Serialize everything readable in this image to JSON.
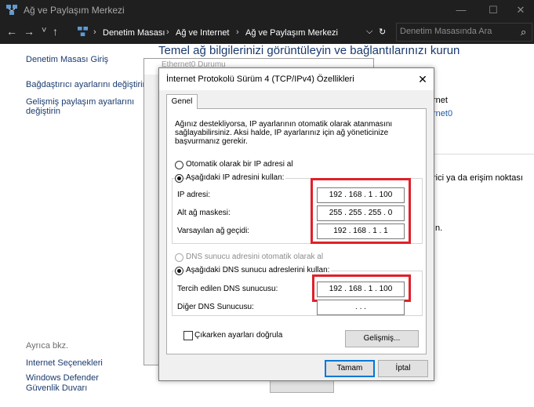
{
  "window": {
    "title": "Ağ ve Paylaşım Merkezi",
    "minimize": "—",
    "maximize": "☐",
    "close": "✕"
  },
  "addressbar": {
    "back": "←",
    "forward": "→",
    "recent": "˅",
    "up": "↑",
    "crumbs": [
      "Denetim Masası",
      "Ağ ve Internet",
      "Ağ ve Paylaşım Merkezi"
    ],
    "separator": "›",
    "dropdown": "⌵",
    "refresh": "↻",
    "search_placeholder": "Denetim Masasında Ara",
    "search_icon": "⌕"
  },
  "sidebar": {
    "home": "Denetim Masası Giriş",
    "items": [
      "Bağdaştırıcı ayarlarını değiştirin",
      "Gelişmiş paylaşım ayarlarını değiştirin"
    ],
    "see_also": "Ayrıca bkz.",
    "see_also_items": [
      "Internet Seçenekleri",
      "Windows Defender Güvenlik Duvarı"
    ]
  },
  "main": {
    "heading": "Temel ağ bilgilerinizi görüntüleyin ve bağlantılarınızı kurun",
    "net_label": "rnet",
    "net_link": "rnet0",
    "router_text": "rici ya da erişim noktası",
    "misc": "ın."
  },
  "ethernet_window": {
    "title": "Ethernet0 Durumu"
  },
  "dialog": {
    "title": "İnternet Protokolü Sürüm 4 (TCP/IPv4) Özellikleri",
    "close": "✕",
    "tab": "Genel",
    "description": "Ağınız destekliyorsa, IP ayarlarının otomatik olarak atanmasını sağlayabilirsiniz. Aksi halde, IP ayarlarınız için ağ yöneticinize başvurmanız gerekir.",
    "ip_auto": "Otomatik olarak bir IP adresi al",
    "ip_manual": "Aşağıdaki IP adresini kullan:",
    "ip_label": "IP adresi:",
    "ip_value": "192 . 168 .  1  . 100",
    "mask_label": "Alt ağ maskesi:",
    "mask_value": "255 . 255 . 255 .  0",
    "gateway_label": "Varsayılan ağ geçidi:",
    "gateway_value": "192 . 168 .  1  .  1",
    "dns_auto": "DNS sunucu adresini otomatik olarak al",
    "dns_manual": "Aşağıdaki DNS sunucu adreslerini kullan:",
    "dns_pref_label": "Tercih edilen DNS sunucusu:",
    "dns_pref_value": "192 . 168 .  1  . 100",
    "dns_alt_label": "Diğer DNS Sunucusu:",
    "dns_alt_value": ".      .      .",
    "validate_label": "Çıkarken ayarları doğrula",
    "advanced": "Gelişmiş...",
    "ok": "Tamam",
    "cancel": "İptal"
  },
  "colors": {
    "highlight": "#e0202a",
    "titlebar": "#1f1f1f",
    "link": "#1a3a6e"
  }
}
